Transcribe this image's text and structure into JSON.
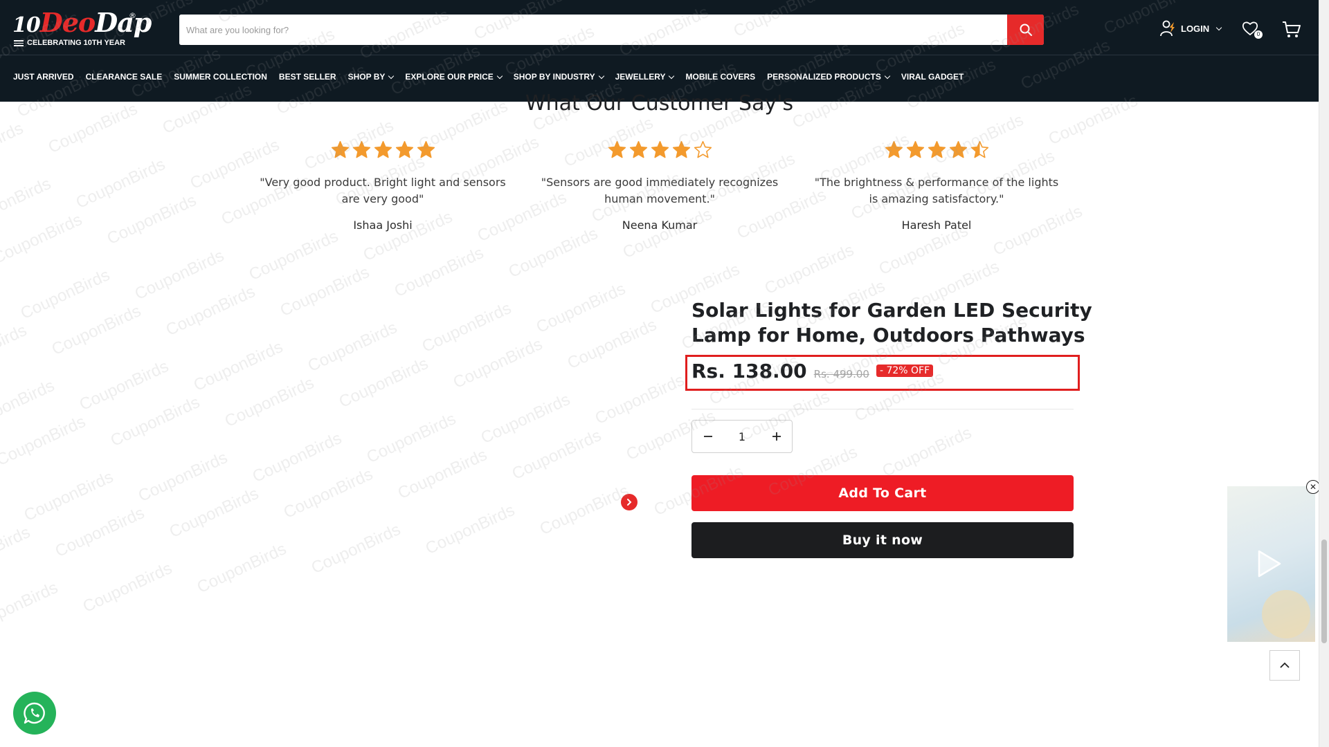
{
  "header": {
    "logo": {
      "ten": "10",
      "brand_red": "Deo",
      "brand_white": "Dap",
      "registered": "®",
      "tagline": "CELEBRATING 10TH YEAR"
    },
    "search": {
      "placeholder": "What are you looking for?",
      "value": ""
    },
    "login_label": "LOGIN",
    "wishlist_count": "0",
    "icons": {
      "search": "search-icon",
      "login": "user-icon",
      "wishlist": "heart-icon",
      "cart": "cart-icon"
    },
    "colors": {
      "header_bg": "#0f1a22",
      "accent": "#e62a2a"
    }
  },
  "nav": {
    "items": [
      {
        "label": "JUST ARRIVED",
        "has_dropdown": false
      },
      {
        "label": "CLEARANCE SALE",
        "has_dropdown": false
      },
      {
        "label": "SUMMER COLLECTION",
        "has_dropdown": false
      },
      {
        "label": "BEST SELLER",
        "has_dropdown": false
      },
      {
        "label": "SHOP BY",
        "has_dropdown": true
      },
      {
        "label": "EXPLORE OUR PRICE",
        "has_dropdown": true
      },
      {
        "label": "SHOP BY INDUSTRY",
        "has_dropdown": true
      },
      {
        "label": "JEWELLERY",
        "has_dropdown": true
      },
      {
        "label": "MOBILE COVERS",
        "has_dropdown": false
      },
      {
        "label": "PERSONALIZED PRODUCTS",
        "has_dropdown": true
      },
      {
        "label": "VIRAL GADGET",
        "has_dropdown": false
      }
    ]
  },
  "testimonials": {
    "title": "What Our Customer Say's",
    "star_color": "#f39a2d",
    "reviews": [
      {
        "rating": 5,
        "quote": "\"Very good product. Bright light and sensors are very good\"",
        "author": "Ishaa Joshi"
      },
      {
        "rating": 4,
        "quote": "\"Sensors are good immediately recognizes human movement.\"",
        "author": "Neena Kumar"
      },
      {
        "rating": 4.5,
        "quote": "\"The brightness & performance of the lights is amazing satisfactory.\"",
        "author": "Haresh Patel"
      }
    ]
  },
  "product": {
    "title": "Solar Lights for Garden LED Security Lamp for Home, Outdoors Pathways",
    "price": "Rs. 138.00",
    "compare_price": "Rs. 499.00",
    "discount": "- 72% OFF",
    "quantity": "1",
    "add_to_cart_label": "Add To Cart",
    "buy_now_label": "Buy it now",
    "colors": {
      "add_to_cart": "#ee1c25",
      "buy_now": "#1c1d1f",
      "highlight_box": "#e01e1e"
    }
  },
  "floating": {
    "video_close_symbol": "✕",
    "icons": {
      "video_play": "play-icon",
      "back_to_top": "chevron-up-icon",
      "whatsapp": "whatsapp-icon",
      "gallery_next": "chevron-right-icon"
    }
  },
  "watermark": {
    "text": "CouponBirds"
  }
}
